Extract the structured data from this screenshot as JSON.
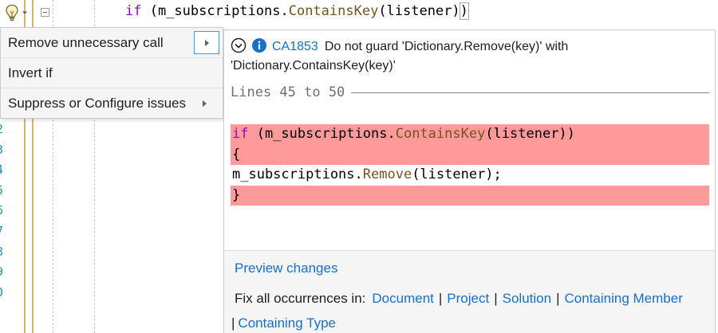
{
  "editor": {
    "top_code": {
      "keyword": "if",
      "open": " (m_subscriptions.",
      "method": "ContainsKey",
      "args": "(listener)",
      "close": ")"
    },
    "line_numbers": [
      "2",
      "3",
      "4",
      "5",
      "6",
      "7",
      "8",
      "9",
      "0"
    ]
  },
  "menu": {
    "items": [
      {
        "label": "Remove unnecessary call",
        "has_submenu": true,
        "selected": true
      },
      {
        "label": "Invert if",
        "has_submenu": false
      },
      {
        "label": "Suppress or Configure issues",
        "has_submenu": true
      }
    ]
  },
  "preview": {
    "diagnostic": {
      "code": "CA1853",
      "message": "Do not guard 'Dictionary.Remove(key)' with 'Dictionary.ContainsKey(key)'",
      "icons": [
        "chevron-down-icon",
        "info-icon"
      ]
    },
    "lines_heading": "Lines 45 to 50",
    "code_lines": {
      "l1": {
        "kw": "if",
        "pre": " (m_subscriptions.",
        "method": "ContainsKey",
        "post": "(listener))"
      },
      "l2": {
        "text": "{"
      },
      "l3": {
        "pre": "m_subscriptions.",
        "method": "Remove",
        "post": "(listener);"
      },
      "l4": {
        "text": "}"
      }
    },
    "footer": {
      "preview_changes": "Preview changes",
      "fix_all_label": "Fix all occurrences in:",
      "scopes": [
        "Document",
        "Project",
        "Solution",
        "Containing Member",
        "Containing Type"
      ],
      "separator": "|"
    }
  },
  "colors": {
    "keyword": "#8f08c4",
    "method": "#74531f",
    "link": "#1a6fc7",
    "removed_line": "#ff9a9a",
    "info": "#1a6fc7"
  }
}
